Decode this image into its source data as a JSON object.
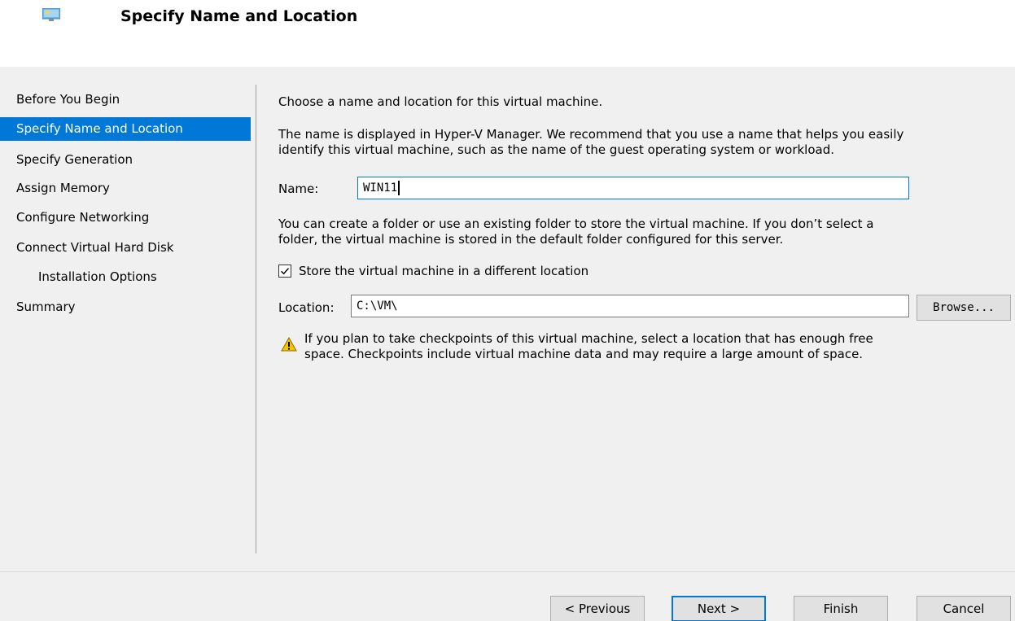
{
  "header": {
    "title": "Specify Name and Location",
    "icon": "vm-monitor-icon"
  },
  "nav": {
    "items": [
      {
        "label": "Before You Begin",
        "selected": false,
        "indent": false
      },
      {
        "label": "Specify Name and Location",
        "selected": true,
        "indent": false
      },
      {
        "label": "Specify Generation",
        "selected": false,
        "indent": false
      },
      {
        "label": "Assign Memory",
        "selected": false,
        "indent": false
      },
      {
        "label": "Configure Networking",
        "selected": false,
        "indent": false
      },
      {
        "label": "Connect Virtual Hard Disk",
        "selected": false,
        "indent": false
      },
      {
        "label": "Installation Options",
        "selected": false,
        "indent": true
      },
      {
        "label": "Summary",
        "selected": false,
        "indent": false
      }
    ]
  },
  "content": {
    "intro": "Choose a name and location for this virtual machine.",
    "description_line1": "The name is displayed in Hyper-V Manager. We recommend that you use a name that helps you easily",
    "description_line2": "identify this virtual machine, such as the name of the guest operating system or workload.",
    "name_label": "Name:",
    "name_value": "WIN11",
    "folder_line1": "You can create a folder or use an existing folder to store the virtual machine. If you don’t select a",
    "folder_line2": "folder, the virtual machine is stored in the default folder configured for this server.",
    "store_checkbox_label": "Store the virtual machine in a different location",
    "store_checkbox_checked": true,
    "location_label": "Location:",
    "location_value": "C:\\VM\\",
    "browse_label": "Browse...",
    "warning_line1": "If you plan to take checkpoints of this virtual machine, select a location that has enough free",
    "warning_line2": "space. Checkpoints include virtual machine data and may require a large amount of space."
  },
  "footer": {
    "previous_label": "< Previous",
    "next_label": "Next >",
    "finish_label": "Finish",
    "cancel_label": "Cancel"
  },
  "colors": {
    "selection": "#0078d7",
    "window_bg": "#f0f0f0",
    "header_bg": "#ffffff",
    "warning": "#f5c400"
  }
}
